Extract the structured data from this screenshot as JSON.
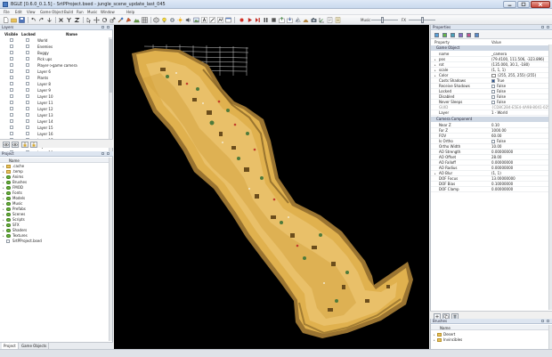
{
  "window": {
    "title": "BGLE [0.6.0_0.1.5] - SrtPProject.bsed - jungle_scene_update_last_045",
    "app_icon": "app-icon",
    "controls": [
      "minimize-icon",
      "maximize-icon",
      "close-icon"
    ]
  },
  "menu": {
    "items": [
      "File",
      "Edit",
      "View",
      "Game Object",
      "Build",
      "Run",
      "Music",
      "Window",
      "Help"
    ],
    "music_label": "Music",
    "music_volume": 0.4,
    "fx_label": "FX",
    "fx_volume": 0.5
  },
  "layers": {
    "title": "Layers",
    "columns": {
      "visible": "Visible",
      "locked": "Locked",
      "name": "Name"
    },
    "rows": [
      {
        "name": "World",
        "visible": true,
        "locked": false
      },
      {
        "name": "Enemies",
        "visible": true,
        "locked": false
      },
      {
        "name": "Buggy",
        "visible": true,
        "locked": false
      },
      {
        "name": "Pick ups",
        "visible": true,
        "locked": false
      },
      {
        "name": "Player->game camera",
        "visible": true,
        "locked": false
      },
      {
        "name": "Layer 6",
        "visible": true,
        "locked": false
      },
      {
        "name": "Plants",
        "visible": true,
        "locked": false
      },
      {
        "name": "Layer 8",
        "visible": true,
        "locked": false
      },
      {
        "name": "Layer 9",
        "visible": true,
        "locked": false
      },
      {
        "name": "Layer 10",
        "visible": true,
        "locked": false
      },
      {
        "name": "Layer 11",
        "visible": true,
        "locked": false
      },
      {
        "name": "Layer 12",
        "visible": true,
        "locked": false
      },
      {
        "name": "Layer 13",
        "visible": true,
        "locked": false
      },
      {
        "name": "Layer 14",
        "visible": true,
        "locked": false
      },
      {
        "name": "Layer 15",
        "visible": true,
        "locked": false
      },
      {
        "name": "Layer 16",
        "visible": true,
        "locked": false
      },
      {
        "name": "Layer 17",
        "visible": true,
        "locked": false
      },
      {
        "name": "Layer 18",
        "visible": true,
        "locked": false
      },
      {
        "name": "Layer 19",
        "visible": true,
        "locked": false
      },
      {
        "name": "Layer 20",
        "visible": true,
        "locked": false
      }
    ]
  },
  "project": {
    "title": "Project",
    "column": "Name",
    "items": [
      {
        "label": ".cache",
        "kind": "folder"
      },
      {
        "label": ".temp",
        "kind": "folder"
      },
      {
        "label": "Anims",
        "kind": "green"
      },
      {
        "label": "Brushes",
        "kind": "green"
      },
      {
        "label": "FMOD",
        "kind": "green"
      },
      {
        "label": "Fonts",
        "kind": "green"
      },
      {
        "label": "Models",
        "kind": "green"
      },
      {
        "label": "Music",
        "kind": "green"
      },
      {
        "label": "Prefabs",
        "kind": "green"
      },
      {
        "label": "Scenes",
        "kind": "green"
      },
      {
        "label": "Scripts",
        "kind": "green"
      },
      {
        "label": "SFX",
        "kind": "green"
      },
      {
        "label": "Shaders",
        "kind": "green"
      },
      {
        "label": "Textures",
        "kind": "green"
      },
      {
        "label": "SrtPProject.bsed",
        "kind": "file"
      }
    ],
    "tabs": [
      "Project",
      "Game Objects"
    ]
  },
  "properties": {
    "title": "Properties",
    "columns": {
      "property": "Property",
      "value": "Value"
    },
    "game_object_section": "Game Object",
    "camera_section": "Camera Component",
    "game_object_rows": [
      {
        "key": "name",
        "value": "_camera"
      },
      {
        "key": "pos",
        "value": "(79.4100, 111.506, -323.896)",
        "expand": true
      },
      {
        "key": "rot",
        "value": "(135.000, 30.1, -180)",
        "expand": true
      },
      {
        "key": "scale",
        "value": "(1, 1, 1)",
        "expand": true
      },
      {
        "key": "Color",
        "value": "(255, 255, 255) (255)",
        "expand": true,
        "swatch": true
      },
      {
        "key": "Casts Shadows",
        "value": "True",
        "checkbox": true,
        "checked": true
      },
      {
        "key": "Receive Shadows",
        "value": "False",
        "checkbox": true,
        "checked": false
      },
      {
        "key": "Locked",
        "value": "False",
        "checkbox": true,
        "checked": false
      },
      {
        "key": "Disabled",
        "value": "False",
        "checkbox": true,
        "checked": false
      },
      {
        "key": "Never Sleeps",
        "value": "False",
        "checkbox": true,
        "checked": false
      },
      {
        "key": "GUID",
        "value": "{CD8C2B4-E5E4-4A98-8041-0258...",
        "dim": true
      },
      {
        "key": "Layer",
        "value": "1 - World"
      }
    ],
    "camera_rows": [
      {
        "key": "Near Z",
        "value": "0.10"
      },
      {
        "key": "Far Z",
        "value": "1000.00"
      },
      {
        "key": "FOV",
        "value": "60.00"
      },
      {
        "key": "Is Ortho",
        "value": "False",
        "checkbox": true,
        "checked": false
      },
      {
        "key": "Ortho Width",
        "value": "10.00"
      },
      {
        "key": "AO Strength",
        "value": "0.00000000"
      },
      {
        "key": "AO Offset",
        "value": "28.00"
      },
      {
        "key": "AO Falloff",
        "value": "0.00000000"
      },
      {
        "key": "AO Radius",
        "value": "0.00000000"
      },
      {
        "key": "AO Blur",
        "value": "(1, 1)",
        "expand": true
      },
      {
        "key": "DOF Focus",
        "value": "13.00000000"
      },
      {
        "key": "DOF Bias",
        "value": "0.10000000"
      },
      {
        "key": "DOF Clamp",
        "value": "0.00000000"
      }
    ]
  },
  "brushes": {
    "title": "Brushes",
    "column": "Name",
    "items": [
      "Desert",
      "Invincibles"
    ]
  },
  "colors": {
    "sand": "#e0b14e",
    "sand_dark": "#9a7431",
    "accent": "#2b5594"
  }
}
